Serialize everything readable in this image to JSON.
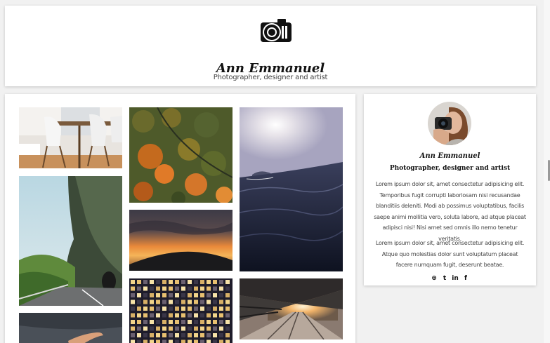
{
  "header": {
    "title": "Ann Emmanuel",
    "subtitle": "Photographer, designer and artist",
    "logo_icon": "camera-icon"
  },
  "gallery": {
    "photos": [
      {
        "name": "photo-dining-room",
        "subject": "dining room with white chairs"
      },
      {
        "name": "photo-autumn-forest",
        "subject": "aerial autumn forest"
      },
      {
        "name": "photo-ocean-sunset",
        "subject": "dark ocean waves at dusk"
      },
      {
        "name": "photo-cliff-road",
        "subject": "road beside green cliff"
      },
      {
        "name": "photo-sunset-hills",
        "subject": "orange sunset over hills"
      },
      {
        "name": "photo-night-building",
        "subject": "lit building windows at night"
      },
      {
        "name": "photo-train-station",
        "subject": "train station platform at sunset"
      },
      {
        "name": "photo-hand-sky",
        "subject": "hand raised against stormy sky"
      }
    ]
  },
  "profile": {
    "name": "Ann Emmanuel",
    "role": "Photographer, designer and artist",
    "bio_1": "Lorem ipsum dolor sit, amet consectetur adipisicing elit. Temporibus fugit corrupti laboriosam nisi recusandae blanditiis deleniti. Modi ab possimus voluptatibus, facilis saepe animi mollitia vero, soluta labore, ad atque placeat adipisci nisi! Nisi amet sed omnis illo nemo tenetur veritatis.",
    "bio_2": "Lorem ipsum dolor sit, amet consectetur adipisicing elit. Atque quo molestias dolor sunt voluptatum placeat facere numquam fugit, deserunt beatae.",
    "social": [
      "dribbble-icon",
      "twitter-icon",
      "linkedin-icon",
      "facebook-icon"
    ],
    "social_glyphs": [
      "⊛",
      "t",
      "in",
      "f"
    ]
  }
}
